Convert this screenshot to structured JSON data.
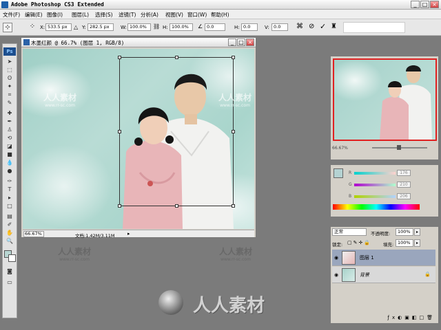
{
  "app": {
    "title": "Adobe Photoshop CS3 Extended",
    "window_controls": [
      "_",
      "□",
      "×"
    ]
  },
  "menu": [
    "文件(F)",
    "编辑(E)",
    "图像(I)",
    "图层(L)",
    "选择(S)",
    "滤镜(T)",
    "分析(A)",
    "视图(V)",
    "窗口(W)",
    "帮助(H)"
  ],
  "options": {
    "x_label": "X:",
    "x_value": "533.5 px",
    "y_label": "Y:",
    "y_value": "282.5 px",
    "w_label": "W:",
    "w_value": "100.0%",
    "h_label": "H:",
    "h_value": "100.0%",
    "angle_value": "0.0",
    "hskew_label": "H:",
    "hskew_value": "0.0",
    "vskew_label": "V:",
    "vskew_value": "0.0"
  },
  "toolbox": {
    "logo": "Ps"
  },
  "document": {
    "title": "木墨红颜 @ 66.7% (图层 1, RGB/8)",
    "zoom": "66.67%",
    "info": "文档:1.42M/3.11M"
  },
  "navigator": {
    "zoom": "66.67%"
  },
  "color": {
    "r_label": "R",
    "r_value": "176",
    "g_label": "G",
    "g_value": "210",
    "b_label": "B",
    "b_value": "206",
    "foreground": "#b0d2ce"
  },
  "layers": {
    "blend_mode": "正常",
    "opacity_label": "不透明度:",
    "opacity_value": "100%",
    "lock_label": "锁定:",
    "fill_label": "填充:",
    "fill_value": "100%",
    "items": [
      {
        "name": "图层 1",
        "selected": true
      },
      {
        "name": "背景",
        "selected": false
      }
    ]
  },
  "watermark": {
    "text": "人人素材",
    "url": "www.rr-sc.com",
    "big_text": "人人素材"
  }
}
